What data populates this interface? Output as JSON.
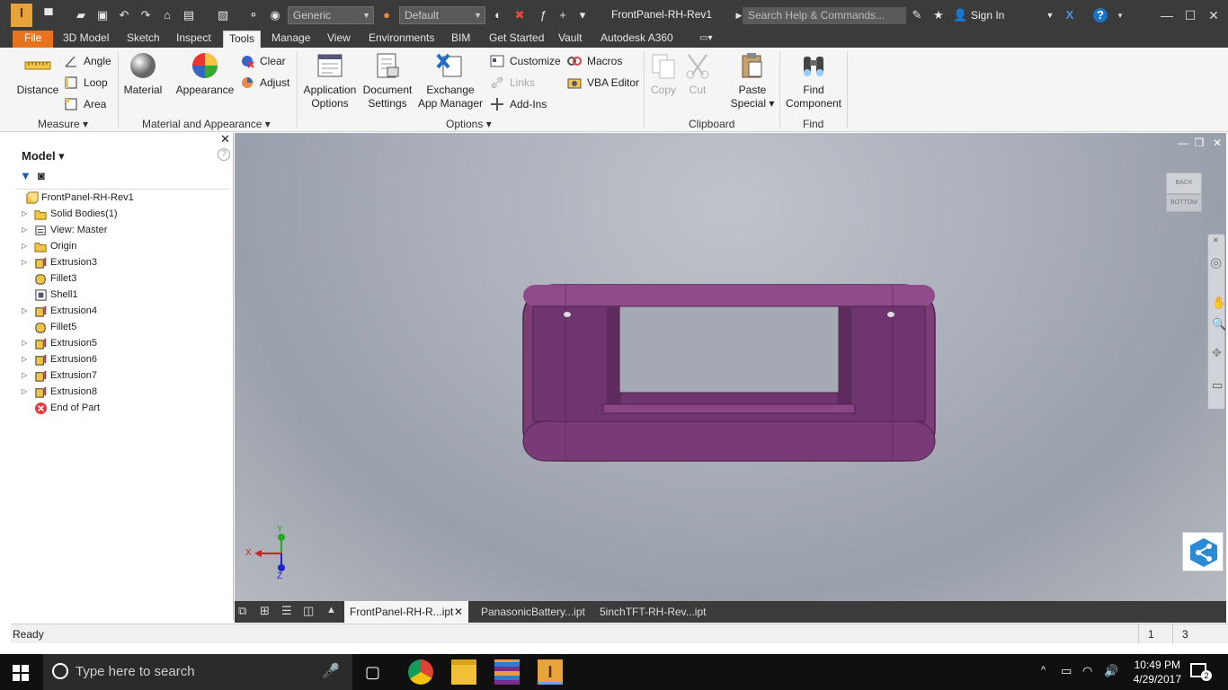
{
  "titlebar": {
    "app_logo": "I",
    "material_combo": "Generic",
    "appearance_combo": "Default",
    "document_title": "FrontPanel-RH-Rev1",
    "search_placeholder": "Search Help & Commands...",
    "sign_in": "Sign In",
    "help": "?"
  },
  "ribbon_tabs": [
    "File",
    "3D Model",
    "Sketch",
    "Inspect",
    "Tools",
    "Manage",
    "View",
    "Environments",
    "BIM",
    "Get Started",
    "Vault",
    "Autodesk A360"
  ],
  "active_tab": "Tools",
  "ribbon": {
    "measure": {
      "title": "Measure",
      "distance": "Distance",
      "angle": "Angle",
      "loop": "Loop",
      "area": "Area"
    },
    "material_appearance": {
      "title": "Material and Appearance",
      "material": "Material",
      "appearance": "Appearance",
      "clear": "Clear",
      "adjust": "Adjust"
    },
    "options": {
      "title": "Options",
      "app_options_1": "Application",
      "app_options_2": "Options",
      "doc_settings_1": "Document",
      "doc_settings_2": "Settings",
      "exchange_1": "Exchange",
      "exchange_2": "App Manager",
      "customize": "Customize",
      "links": "Links",
      "addins": "Add-Ins",
      "macros": "Macros",
      "vba": "VBA Editor"
    },
    "clipboard": {
      "title": "Clipboard",
      "copy": "Copy",
      "cut": "Cut",
      "paste_1": "Paste",
      "paste_2": "Special"
    },
    "find": {
      "title": "Find",
      "find_1": "Find",
      "find_2": "Component"
    }
  },
  "browser": {
    "title": "Model",
    "help": "?",
    "items": [
      {
        "label": "FrontPanel-RH-Rev1",
        "expand": false,
        "root": true,
        "icon": "part-icon"
      },
      {
        "label": "Solid Bodies(1)",
        "expand": true,
        "icon": "folder-icon"
      },
      {
        "label": "View: Master",
        "expand": true,
        "icon": "view-icon"
      },
      {
        "label": "Origin",
        "expand": true,
        "icon": "folder-icon"
      },
      {
        "label": "Extrusion3",
        "expand": true,
        "icon": "extrusion-icon"
      },
      {
        "label": "Fillet3",
        "expand": false,
        "icon": "fillet-icon"
      },
      {
        "label": "Shell1",
        "expand": false,
        "icon": "shell-icon"
      },
      {
        "label": "Extrusion4",
        "expand": true,
        "icon": "extrusion-icon"
      },
      {
        "label": "Fillet5",
        "expand": false,
        "icon": "fillet-icon"
      },
      {
        "label": "Extrusion5",
        "expand": true,
        "icon": "extrusion-icon"
      },
      {
        "label": "Extrusion6",
        "expand": true,
        "icon": "extrusion-icon"
      },
      {
        "label": "Extrusion7",
        "expand": true,
        "icon": "extrusion-icon"
      },
      {
        "label": "Extrusion8",
        "expand": true,
        "icon": "extrusion-icon"
      },
      {
        "label": "End of Part",
        "expand": false,
        "icon": "end-of-part-icon"
      }
    ]
  },
  "viewcube": {
    "face1": "BACK",
    "face2": "BOTTOM"
  },
  "triad": {
    "x": "X",
    "y": "Y",
    "z": "Z"
  },
  "doc_tabs": [
    {
      "label": "FrontPanel-RH-R...ipt",
      "active": true
    },
    {
      "label": "PanasonicBattery...ipt",
      "active": false
    },
    {
      "label": "5inchTFT-RH-Rev...ipt",
      "active": false
    }
  ],
  "status": {
    "text": "Ready",
    "count1": "1",
    "count2": "3"
  },
  "taskbar": {
    "search_placeholder": "Type here to search",
    "time": "10:49 PM",
    "date": "4/29/2017",
    "notifications": "2"
  },
  "colors": {
    "file_tab": "#e8731c",
    "part": "#7b3c78",
    "titlebar": "#3b3b3b"
  }
}
